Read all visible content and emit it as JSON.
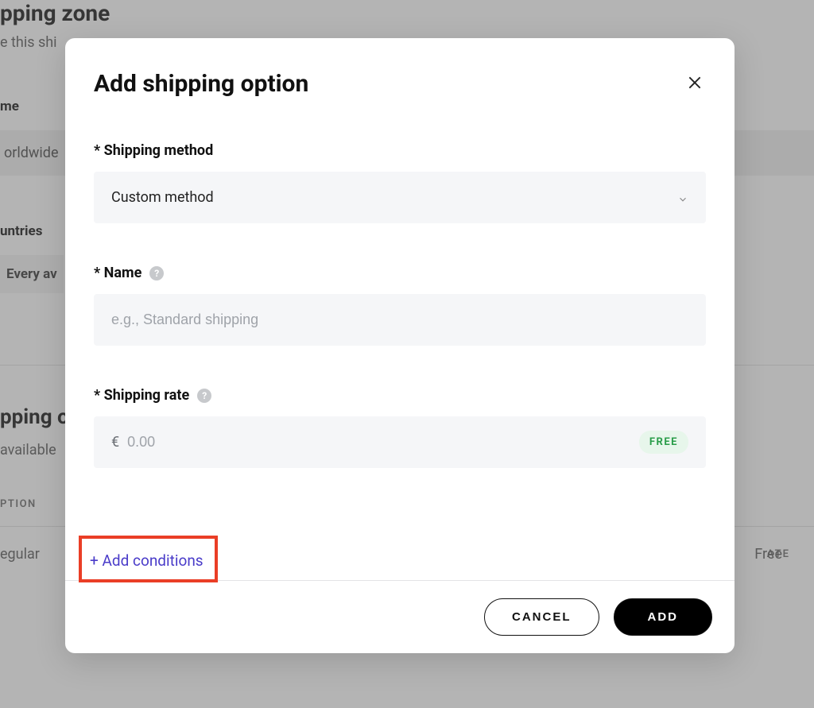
{
  "background": {
    "heading": "pping zone",
    "subtext": "e this shi",
    "name_label": "me",
    "name_value": "orldwide",
    "countries_label": "untries",
    "countries_value": "Every av",
    "options_heading": "pping o",
    "options_sub": "available",
    "option_col": "PTION",
    "rate_col": "ATE",
    "option_row": "egular",
    "rate_val": "Free"
  },
  "modal": {
    "title": "Add shipping option",
    "shipping_method_label": "* Shipping method",
    "shipping_method_value": "Custom method",
    "name_label": "* Name",
    "name_placeholder": "e.g., Standard shipping",
    "rate_label": "* Shipping rate",
    "currency": "€",
    "rate_placeholder": "0.00",
    "free_badge": "FREE",
    "add_conditions": "+ Add conditions",
    "cancel": "CANCEL",
    "add": "ADD"
  }
}
